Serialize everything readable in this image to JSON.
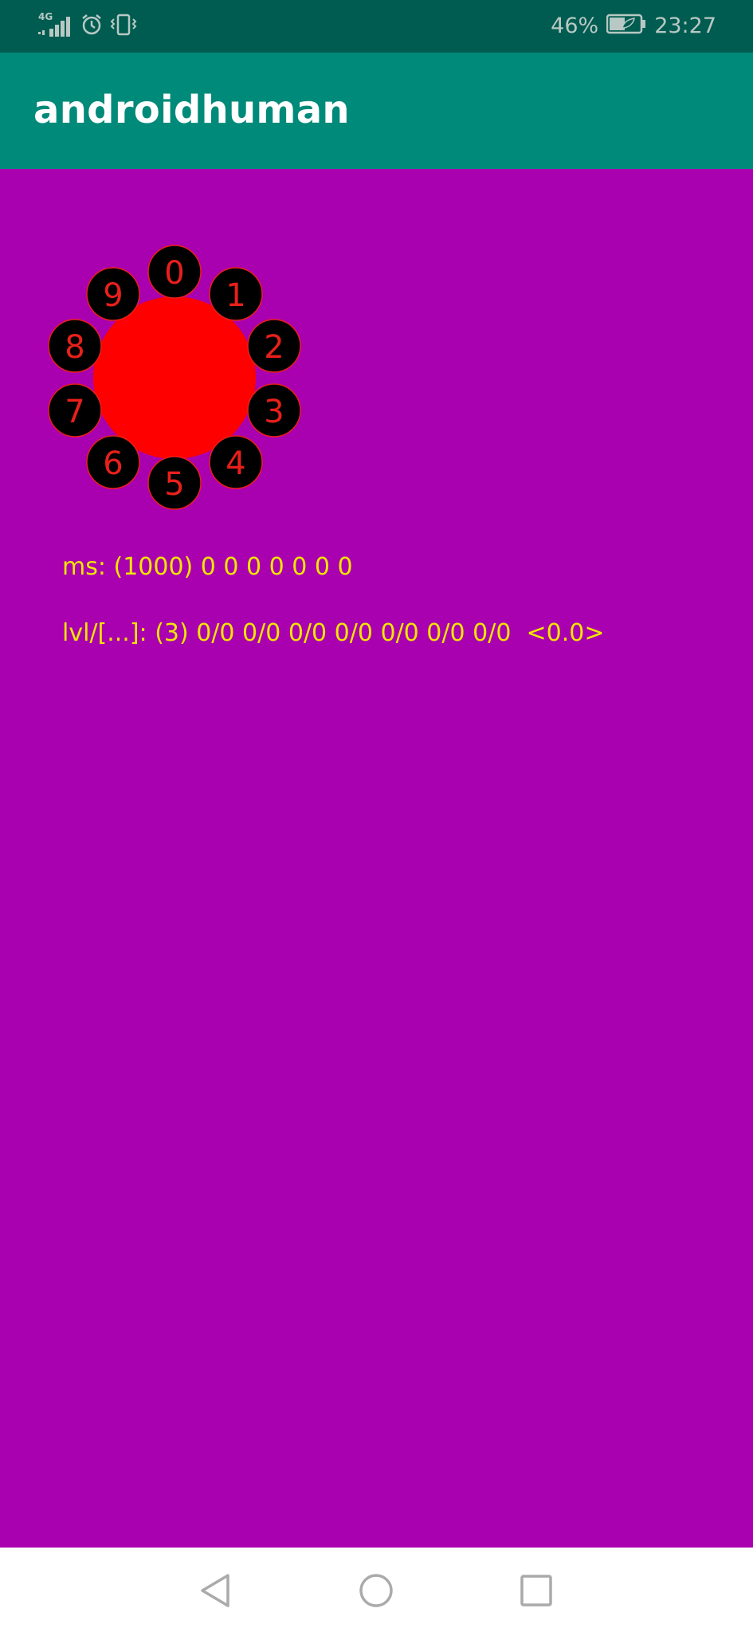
{
  "status_bar": {
    "network_label": "4G",
    "battery_percent": "46%",
    "time": "23:27",
    "icons": [
      "signal-icon",
      "alarm-icon",
      "vibrate-icon",
      "battery-icon"
    ]
  },
  "app_bar": {
    "title": "androidhuman"
  },
  "dial": {
    "buttons": [
      "0",
      "1",
      "2",
      "3",
      "4",
      "5",
      "6",
      "7",
      "8",
      "9"
    ],
    "center_color": "#ff0000",
    "button_color": "#000000",
    "label_color": "#e8201a"
  },
  "info": {
    "ms_line": "ms: (1000) 0 0 0 0 0 0 0",
    "lvl_line": "lvl/[...]: (3) 0/0 0/0 0/0 0/0 0/0 0/0 0/0  <0.0>"
  },
  "nav_bar": {
    "icons": [
      "back-icon",
      "home-icon",
      "recents-icon"
    ]
  },
  "colors": {
    "status_bar": "#005c50",
    "app_bar": "#008a7a",
    "background": "#a900b0",
    "info_text": "#f2e600",
    "nav_bar": "#ffffff"
  }
}
